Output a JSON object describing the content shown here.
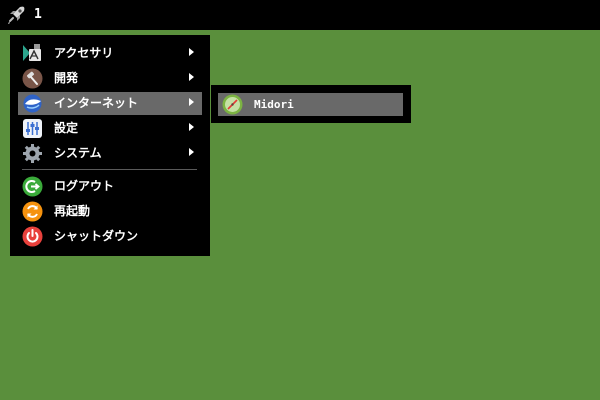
{
  "desktop": {
    "background": "#5a8f3c"
  },
  "panel": {
    "launcher_icon": "rocket-icon",
    "workspace_number": "1"
  },
  "main_menu": {
    "items": [
      {
        "label": "アクセサリ",
        "icon": "accessories-icon",
        "has_submenu": true
      },
      {
        "label": "開発",
        "icon": "hammer-icon",
        "has_submenu": true
      },
      {
        "label": "インターネット",
        "icon": "globe-icon",
        "has_submenu": true,
        "highlighted": true
      },
      {
        "label": "設定",
        "icon": "settings-panel-icon",
        "has_submenu": true
      },
      {
        "label": "システム",
        "icon": "gear-icon",
        "has_submenu": true
      }
    ],
    "actions": [
      {
        "label": "ログアウト",
        "icon": "logout-icon"
      },
      {
        "label": "再起動",
        "icon": "restart-icon"
      },
      {
        "label": "シャットダウン",
        "icon": "power-icon"
      }
    ]
  },
  "submenu": {
    "items": [
      {
        "label": "Midori",
        "icon": "midori-browser-icon",
        "highlighted": true
      }
    ]
  },
  "colors": {
    "panel": "#000000",
    "menu_background": "#000000",
    "highlight": "#696969",
    "text": "#ffffff",
    "logout": "#3aaa3a",
    "restart": "#f5920e",
    "power": "#e8413c",
    "internet": "#2f63c8"
  }
}
